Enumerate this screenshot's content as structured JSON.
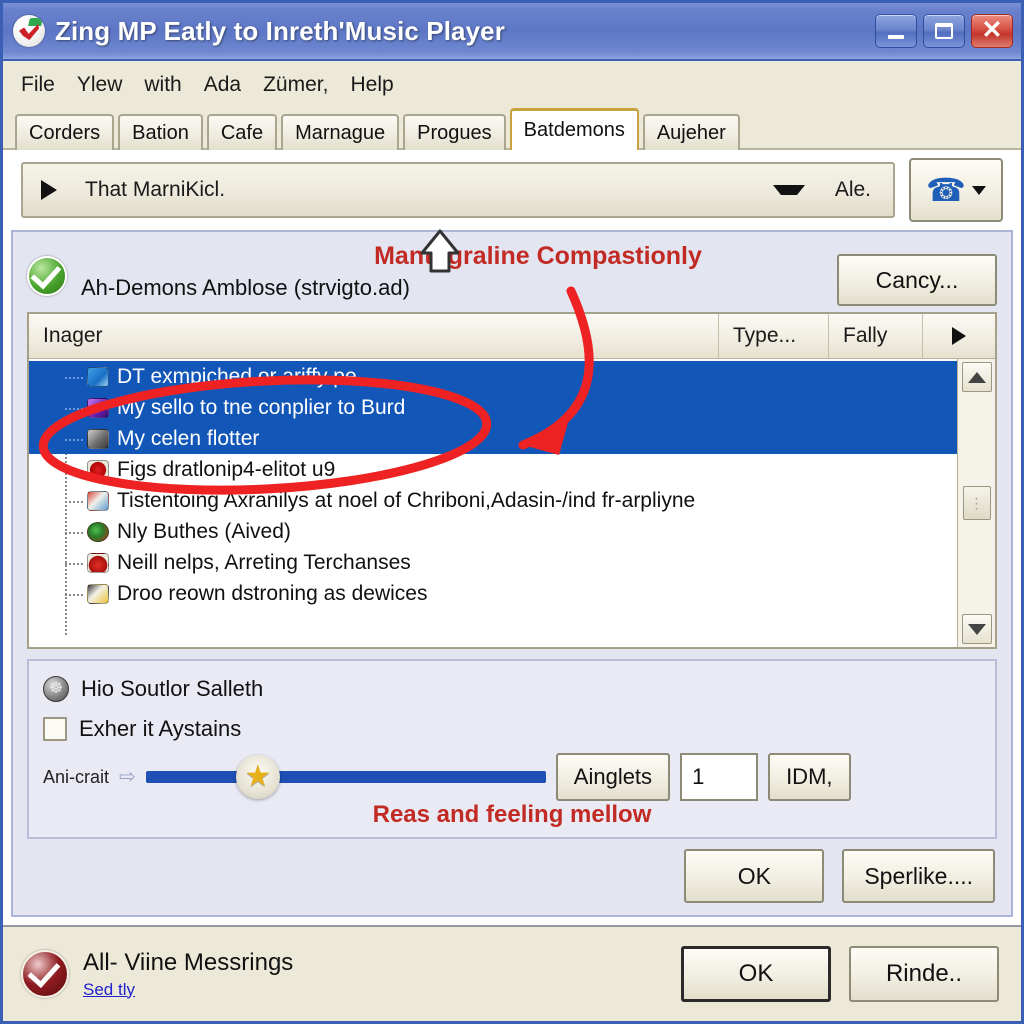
{
  "window": {
    "title": "Zing MP Eatly to Inreth'Music Player",
    "app_icon": "checkmark-app-icon",
    "buttons": {
      "minimize": "minimize-icon",
      "maximize": "maximize-icon",
      "close": "close-icon"
    }
  },
  "menubar": {
    "items": [
      {
        "label": "File"
      },
      {
        "label": "Ylew"
      },
      {
        "label": "with"
      },
      {
        "label": "Ada"
      },
      {
        "label": "Zümer,"
      },
      {
        "label": "Help"
      }
    ]
  },
  "tabs": {
    "active_index": 5,
    "items": [
      {
        "label": "Corders"
      },
      {
        "label": "Bation"
      },
      {
        "label": "Cafe"
      },
      {
        "label": "Marnague"
      },
      {
        "label": "Progues"
      },
      {
        "label": "Batdemons"
      },
      {
        "label": "Aujeher"
      }
    ]
  },
  "combo": {
    "play_icon": "play-triangle-icon",
    "value": "That MarniKicl.",
    "caret_icon": "chevron-down-icon",
    "suffix_label": "Ale.",
    "phone_button": {
      "icon": "phone-icon",
      "caret": "chevron-down-icon"
    }
  },
  "panel": {
    "callout": "Mantograline Compastionly",
    "status_icon": "green-check-icon",
    "subject": "Ah-Demons Amblose (strvigto.ad)",
    "cancel_label": "Cancy..."
  },
  "list": {
    "columns": [
      {
        "label": "Inager"
      },
      {
        "label": "Type..."
      },
      {
        "label": "Fally"
      },
      {
        "label": "▶"
      }
    ],
    "rows": [
      {
        "label": "DT exmpiched or ariffy pe",
        "icon": "blue-gradient-icon",
        "selected": true
      },
      {
        "label": "My sello to tne conplier to Burd",
        "icon": "purple-gradient-icon",
        "selected": true
      },
      {
        "label": "My celen flotter",
        "icon": "camera-icon",
        "selected": true
      },
      {
        "label": "Figs dratlonip4-elitot u9",
        "icon": "red-dot-icon",
        "selected": false
      },
      {
        "label": "Tistentoing Axranilys at noel of Chriboni,Adasin-/ind fr-arpliyne",
        "icon": "mixed-tile-icon",
        "selected": false
      },
      {
        "label": "Nly Buthes (Aived)",
        "icon": "globe-icon",
        "selected": false
      },
      {
        "label": "Neill nelps, Arreting Terchanses",
        "icon": "red-bell-icon",
        "selected": false
      },
      {
        "label": "Droo reown dstroning as dewices",
        "icon": "yellow-folder-icon",
        "selected": false
      }
    ],
    "scrollbar": {
      "up_icon": "scroll-up-icon",
      "down_icon": "scroll-down-icon",
      "thumb": "scroll-thumb"
    }
  },
  "options": {
    "title_icon": "gear-icon",
    "title": "Hio Soutlor Salleth",
    "checkbox": {
      "label": "Exher it Aystains",
      "checked": false
    },
    "slider": {
      "label": "Ani-crait",
      "arrow_icon": "right-arrow-icon",
      "thumb_icon": "star-icon",
      "value_percent": 28
    },
    "ainglets_label": "Ainglets",
    "number_value": "1",
    "idm_label": "IDM,",
    "mellow_note": "Reas and feeling mellow"
  },
  "dialog_buttons": [
    {
      "label": "OK"
    },
    {
      "label": "Sperlike...."
    }
  ],
  "statusbar": {
    "icon": "dark-red-check-icon",
    "text": "All- Viine Messrings",
    "link": "Sed tly",
    "buttons": [
      {
        "label": "OK",
        "default": true
      },
      {
        "label": "Rinde..",
        "default": false
      }
    ]
  },
  "annotations": {
    "up_arrow": "up-arrow-annotation",
    "ellipse": "red-ellipse-annotation",
    "curved_arrow": "red-curved-arrow-annotation",
    "color": "#ee2222"
  }
}
